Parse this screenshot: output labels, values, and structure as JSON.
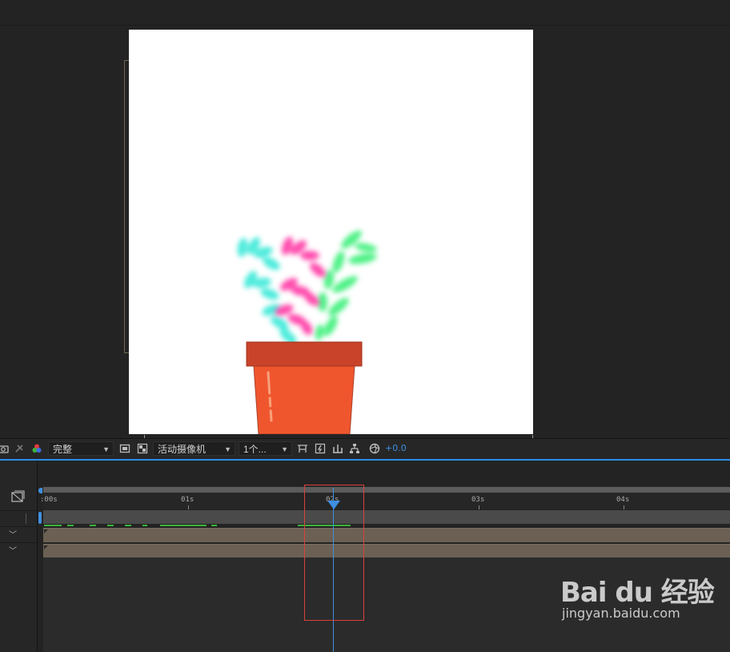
{
  "viewer": {
    "toolbar": {
      "resolution": "完整",
      "camera": "活动摄像机",
      "views": "1个...",
      "exposure": "+0.0"
    }
  },
  "timeline": {
    "ruler_labels": [
      ":00s",
      "01s",
      "02s",
      "03s",
      "04s"
    ],
    "current_time_label": "02s"
  },
  "colors": {
    "accent": "#3f8fe0",
    "highlight_box": "#d9423c",
    "cache": "#3bb53b",
    "layer_bar": "#6b6053",
    "pot": "#f0562e",
    "pot_rim": "#c8432a"
  },
  "watermark": {
    "logo": "Bai du 经验",
    "url": "jingyan.baidu.com"
  }
}
